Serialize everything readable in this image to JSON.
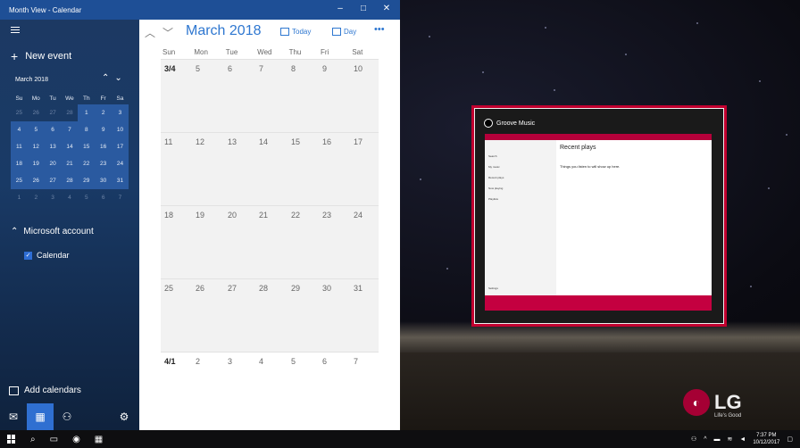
{
  "window": {
    "title": "Month View - Calendar",
    "controls": [
      "–",
      "□",
      "✕"
    ]
  },
  "sidebar": {
    "new_event": "New event",
    "mini_calendar": {
      "month": "March 2018",
      "days_of_week": [
        "Su",
        "Mo",
        "Tu",
        "We",
        "Th",
        "Fr",
        "Sa"
      ],
      "weeks": [
        [
          "25",
          "26",
          "27",
          "28",
          "1",
          "2",
          "3"
        ],
        [
          "4",
          "5",
          "6",
          "7",
          "8",
          "9",
          "10"
        ],
        [
          "11",
          "12",
          "13",
          "14",
          "15",
          "16",
          "17"
        ],
        [
          "18",
          "19",
          "20",
          "21",
          "22",
          "23",
          "24"
        ],
        [
          "25",
          "26",
          "27",
          "28",
          "29",
          "30",
          "31"
        ],
        [
          "1",
          "2",
          "3",
          "4",
          "5",
          "6",
          "7"
        ]
      ]
    },
    "account": "Microsoft account",
    "calendar_item": "Calendar",
    "add_calendars": "Add calendars"
  },
  "main": {
    "month_title": "March 2018",
    "today_label": "Today",
    "day_label": "Day",
    "more_label": "•••",
    "days_of_week": [
      "Sun",
      "Mon",
      "Tue",
      "Wed",
      "Thu",
      "Fri",
      "Sat"
    ],
    "weeks": [
      [
        "3/4",
        "5",
        "6",
        "7",
        "8",
        "9",
        "10"
      ],
      [
        "11",
        "12",
        "13",
        "14",
        "15",
        "16",
        "17"
      ],
      [
        "18",
        "19",
        "20",
        "21",
        "22",
        "23",
        "24"
      ],
      [
        "25",
        "26",
        "27",
        "28",
        "29",
        "30",
        "31"
      ],
      [
        "4/1",
        "2",
        "3",
        "4",
        "5",
        "6",
        "7"
      ]
    ]
  },
  "groove": {
    "app_name": "Groove Music",
    "heading": "Recent plays",
    "message": "Things you listen to will show up here.",
    "nav_items": [
      "Search",
      "My music",
      "Recent plays",
      "Now playing",
      "Playlists",
      "Settings"
    ]
  },
  "brand": {
    "logo": "LG",
    "tagline": "Life's Good"
  },
  "taskbar": {
    "time": "7:37 PM",
    "date": "10/12/2017"
  },
  "colors": {
    "accent": "#2e77d0",
    "titlebar": "#1e4f96",
    "groove": "#c2002f"
  }
}
